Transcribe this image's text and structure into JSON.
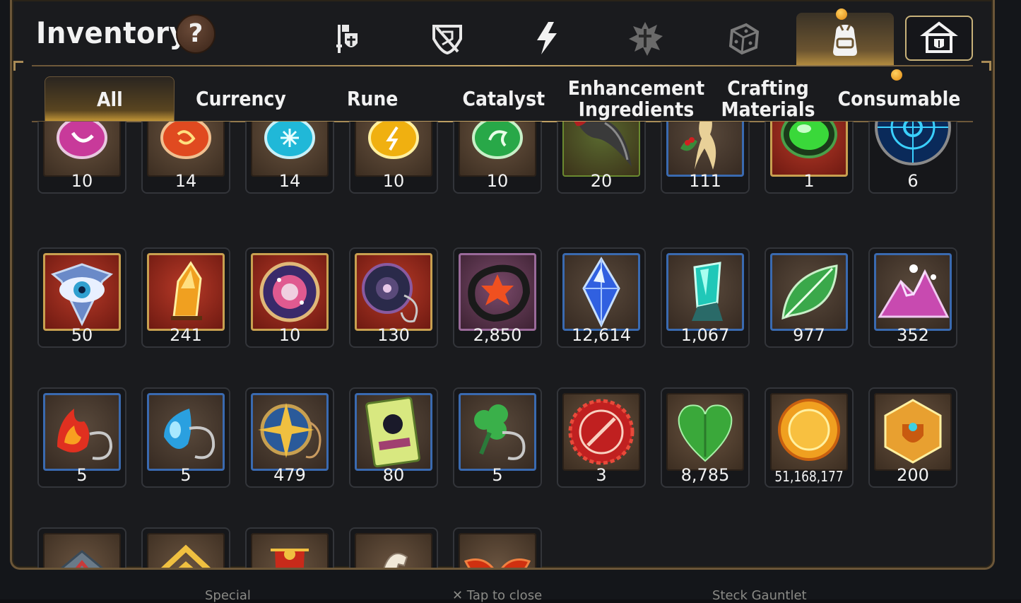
{
  "header": {
    "title": "Inventory",
    "help": "?"
  },
  "top_tabs": [
    {
      "icon": "sword-shield-icon"
    },
    {
      "icon": "broken-shield-icon"
    },
    {
      "icon": "lightning-icon"
    },
    {
      "icon": "spiky-emblem-icon"
    },
    {
      "icon": "cube-icon"
    },
    {
      "icon": "backpack-icon",
      "active": true
    },
    {
      "icon": "guild-hall-icon"
    }
  ],
  "category_tabs": [
    {
      "label": "All",
      "active": true
    },
    {
      "label": "Currency"
    },
    {
      "label": "Rune"
    },
    {
      "label": "Catalyst"
    },
    {
      "label": "Enhancement Ingredients"
    },
    {
      "label": "Crafting Materials"
    },
    {
      "label": "Consumable"
    }
  ],
  "items": [
    {
      "icon": "pink-gem-icon",
      "count": "10"
    },
    {
      "icon": "red-gem-icon",
      "count": "14"
    },
    {
      "icon": "cyan-gem-icon",
      "count": "14"
    },
    {
      "icon": "yellow-gem-icon",
      "count": "10"
    },
    {
      "icon": "green-gem-icon",
      "count": "10"
    },
    {
      "icon": "claw-icon",
      "count": "20"
    },
    {
      "icon": "root-icon",
      "count": "111"
    },
    {
      "icon": "green-orb-icon",
      "count": "1"
    },
    {
      "icon": "blue-rune-disc-icon",
      "count": "6"
    },
    {
      "icon": "eye-crest-icon",
      "count": "50"
    },
    {
      "icon": "fire-crystal-icon",
      "count": "241"
    },
    {
      "icon": "cosmic-disc-icon",
      "count": "10"
    },
    {
      "icon": "dark-disc-icon",
      "count": "130"
    },
    {
      "icon": "flower-ring-icon",
      "count": "2,850"
    },
    {
      "icon": "blue-crystal-icon",
      "count": "12,614"
    },
    {
      "icon": "teal-crystal-icon",
      "count": "1,067"
    },
    {
      "icon": "leaf-icon",
      "count": "977"
    },
    {
      "icon": "pink-mountain-icon",
      "count": "352"
    },
    {
      "icon": "fire-amulet-icon",
      "count": "5"
    },
    {
      "icon": "water-amulet-icon",
      "count": "5"
    },
    {
      "icon": "star-amulet-icon",
      "count": "479"
    },
    {
      "icon": "card-icon",
      "count": "80"
    },
    {
      "icon": "clover-amulet-icon",
      "count": "5"
    },
    {
      "icon": "red-seal-icon",
      "count": "3"
    },
    {
      "icon": "green-heart-icon",
      "count": "8,785"
    },
    {
      "icon": "gold-coin-icon",
      "count": "51,168,177"
    },
    {
      "icon": "gold-hex-emblem-icon",
      "count": "200"
    },
    {
      "icon": "stone-tablet-icon",
      "count": ""
    },
    {
      "icon": "gold-roof-icon",
      "count": ""
    },
    {
      "icon": "red-banner-icon",
      "count": ""
    },
    {
      "icon": "horse-icon",
      "count": ""
    },
    {
      "icon": "red-wings-icon",
      "count": ""
    }
  ],
  "background_text": {
    "left": "Special",
    "center": "✕ Tap to close",
    "right": "Steck Gauntlet"
  },
  "colors": {
    "panel_bg": "#1a1b1e",
    "gold_border": "#c8a868",
    "active_tab": "#c89a38",
    "notify_dot": "#f0a020"
  }
}
